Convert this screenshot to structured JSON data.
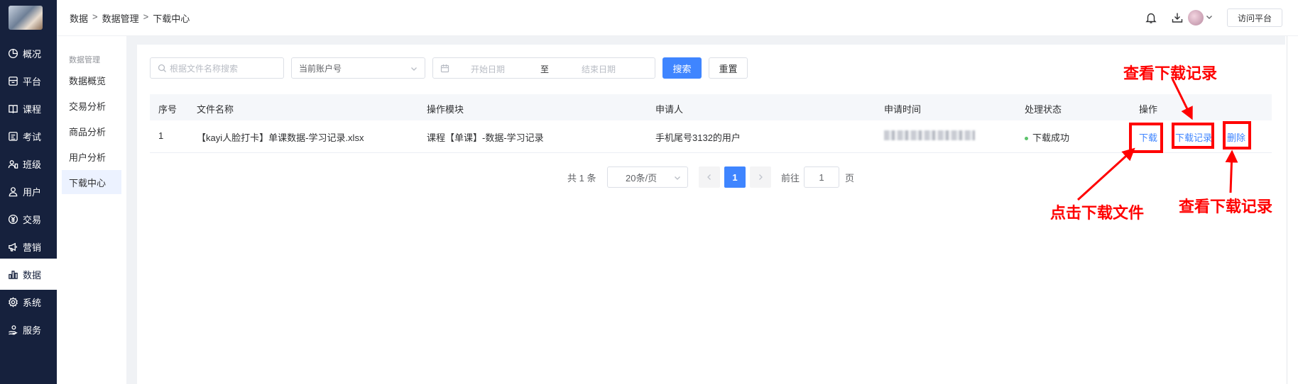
{
  "nav": {
    "items": [
      {
        "label": "概况",
        "icon": "pie-chart-icon"
      },
      {
        "label": "平台",
        "icon": "platform-icon"
      },
      {
        "label": "课程",
        "icon": "book-icon"
      },
      {
        "label": "考试",
        "icon": "exam-icon"
      },
      {
        "label": "班级",
        "icon": "class-icon"
      },
      {
        "label": "用户",
        "icon": "user-icon"
      },
      {
        "label": "交易",
        "icon": "currency-icon"
      },
      {
        "label": "营销",
        "icon": "megaphone-icon"
      },
      {
        "label": "数据",
        "icon": "bar-chart-icon",
        "active": true
      },
      {
        "label": "系统",
        "icon": "settings-icon"
      },
      {
        "label": "服务",
        "icon": "service-icon"
      }
    ]
  },
  "header": {
    "breadcrumb": [
      "数据",
      "数据管理",
      "下载中心"
    ],
    "separator": ">",
    "visit_button": "访问平台",
    "icons": [
      "bell-icon",
      "download-icon",
      "avatar",
      "chevron-down-icon"
    ]
  },
  "subnav": {
    "title": "数据管理",
    "items": [
      {
        "label": "数据概览"
      },
      {
        "label": "交易分析"
      },
      {
        "label": "商品分析"
      },
      {
        "label": "用户分析"
      },
      {
        "label": "下载中心",
        "active": true
      }
    ]
  },
  "filters": {
    "search_placeholder": "根据文件名称搜索",
    "account_select": "当前账户号",
    "start_date_placeholder": "开始日期",
    "date_separator": "至",
    "end_date_placeholder": "结束日期",
    "search_button": "搜索",
    "reset_button": "重置"
  },
  "table": {
    "columns": [
      "序号",
      "文件名称",
      "操作模块",
      "申请人",
      "申请时间",
      "处理状态",
      "操作"
    ],
    "rows": [
      {
        "index": "1",
        "file_name": "【kayi人脸打卡】单课数据-学习记录.xlsx",
        "module": "课程【单课】-数据-学习记录",
        "applicant": "手机尾号3132的用户",
        "status": "下载成功",
        "actions": [
          "下载",
          "下载记录",
          "删除"
        ]
      }
    ]
  },
  "pagination": {
    "total": "共 1 条",
    "page_size": "20条/页",
    "current_page": "1",
    "goto_label": "前往",
    "goto_value": "1",
    "page_suffix": "页"
  },
  "annotations": {
    "top_label": "查看下载记录",
    "left_label": "点击下载文件",
    "right_label": "查看下载记录",
    "color": "#ff0000"
  },
  "colors": {
    "nav_bg": "#16213d",
    "primary": "#3f85ff",
    "success": "#5cc36b"
  }
}
